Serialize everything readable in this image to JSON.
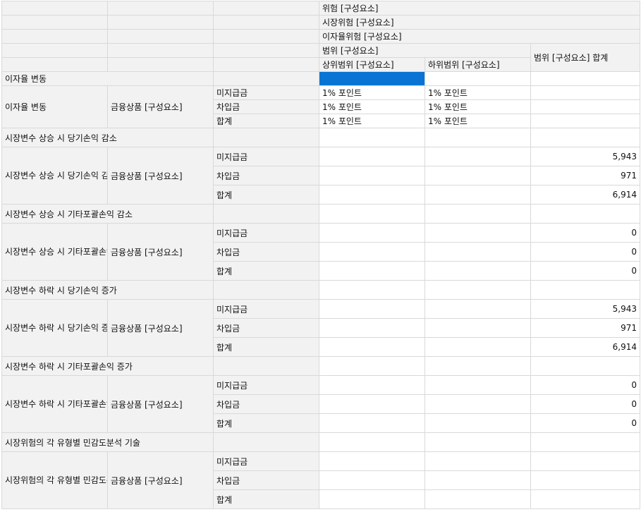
{
  "header": {
    "risk": "위험 [구성요소]",
    "market_risk": "시장위험 [구성요소]",
    "interest_risk": "이자율위험 [구성요소]",
    "range": "범위 [구성요소]",
    "range_total": "범위 [구성요소] 합계",
    "upper_range": "상위범위 [구성요소]",
    "lower_range": "하위범위 [구성요소]"
  },
  "sections": [
    {
      "title": "이자율 변동",
      "label": "이자율 변동",
      "member": "금융상품 [구성요소]",
      "rows": [
        {
          "item": "미지급금",
          "upper": "1% 포인트",
          "lower": "1% 포인트",
          "total": ""
        },
        {
          "item": "차입금",
          "upper": "1% 포인트",
          "lower": "1% 포인트",
          "total": ""
        },
        {
          "item": "합계",
          "upper": "1% 포인트",
          "lower": "1% 포인트",
          "total": ""
        }
      ]
    },
    {
      "title": "시장변수 상승 시 당기손익 감소",
      "label": "시장변수 상승 시 당기손익 감소",
      "member": "금융상품 [구성요소]",
      "rows": [
        {
          "item": "미지급금",
          "upper": "",
          "lower": "",
          "total": "5,943"
        },
        {
          "item": "차입금",
          "upper": "",
          "lower": "",
          "total": "971"
        },
        {
          "item": "합계",
          "upper": "",
          "lower": "",
          "total": "6,914"
        }
      ]
    },
    {
      "title": "시장변수 상승 시 기타포괄손익 감소",
      "label": "시장변수 상승 시 기타포괄손익 감소",
      "member": "금융상품 [구성요소]",
      "rows": [
        {
          "item": "미지급금",
          "upper": "",
          "lower": "",
          "total": "0"
        },
        {
          "item": "차입금",
          "upper": "",
          "lower": "",
          "total": "0"
        },
        {
          "item": "합계",
          "upper": "",
          "lower": "",
          "total": "0"
        }
      ]
    },
    {
      "title": "시장변수 하락 시 당기손익 증가",
      "label": "시장변수 하락 시 당기손익 증가",
      "member": "금융상품 [구성요소]",
      "rows": [
        {
          "item": "미지급금",
          "upper": "",
          "lower": "",
          "total": "5,943"
        },
        {
          "item": "차입금",
          "upper": "",
          "lower": "",
          "total": "971"
        },
        {
          "item": "합계",
          "upper": "",
          "lower": "",
          "total": "6,914"
        }
      ]
    },
    {
      "title": "시장변수 하락 시 기타포괄손익 증가",
      "label": "시장변수 하락 시 기타포괄손익 증가",
      "member": "금융상품 [구성요소]",
      "rows": [
        {
          "item": "미지급금",
          "upper": "",
          "lower": "",
          "total": "0"
        },
        {
          "item": "차입금",
          "upper": "",
          "lower": "",
          "total": "0"
        },
        {
          "item": "합계",
          "upper": "",
          "lower": "",
          "total": "0"
        }
      ]
    },
    {
      "title": "시장위험의 각 유형별 민감도분석 기술",
      "label": "시장위험의 각 유형별 민감도분석 기술",
      "member": "금융상품 [구성요소]",
      "rows": [
        {
          "item": "미지급금",
          "upper": "",
          "lower": "",
          "total": ""
        },
        {
          "item": "차입금",
          "upper": "",
          "lower": "",
          "total": ""
        },
        {
          "item": "합계",
          "upper": "",
          "lower": "",
          "total": ""
        }
      ]
    }
  ]
}
